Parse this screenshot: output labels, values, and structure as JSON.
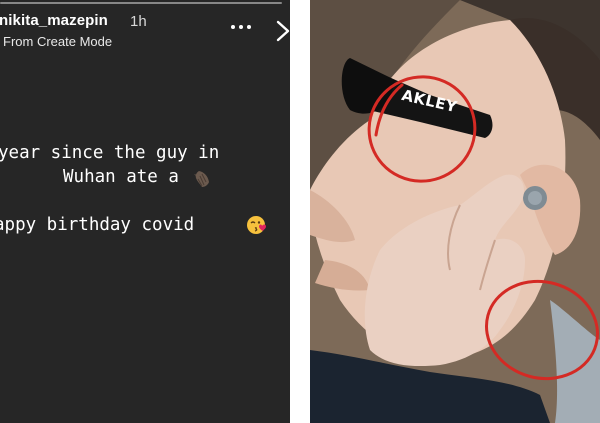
{
  "story": {
    "username": "nikita_mazepin",
    "time": "1h",
    "subtitle": "From Create Mode",
    "lines": [
      "year since the guy in",
      "Wuhan ate a",
      "appy birthday covid"
    ],
    "icons": {
      "more": "more-dots-icon",
      "close": "close-chevron-icon",
      "bat": "bat-emoji",
      "kiss": "face-blowing-kiss-emoji"
    }
  },
  "photo": {
    "sunglasses_brand": "AKLEY",
    "highlight_color": "#d42a24"
  }
}
